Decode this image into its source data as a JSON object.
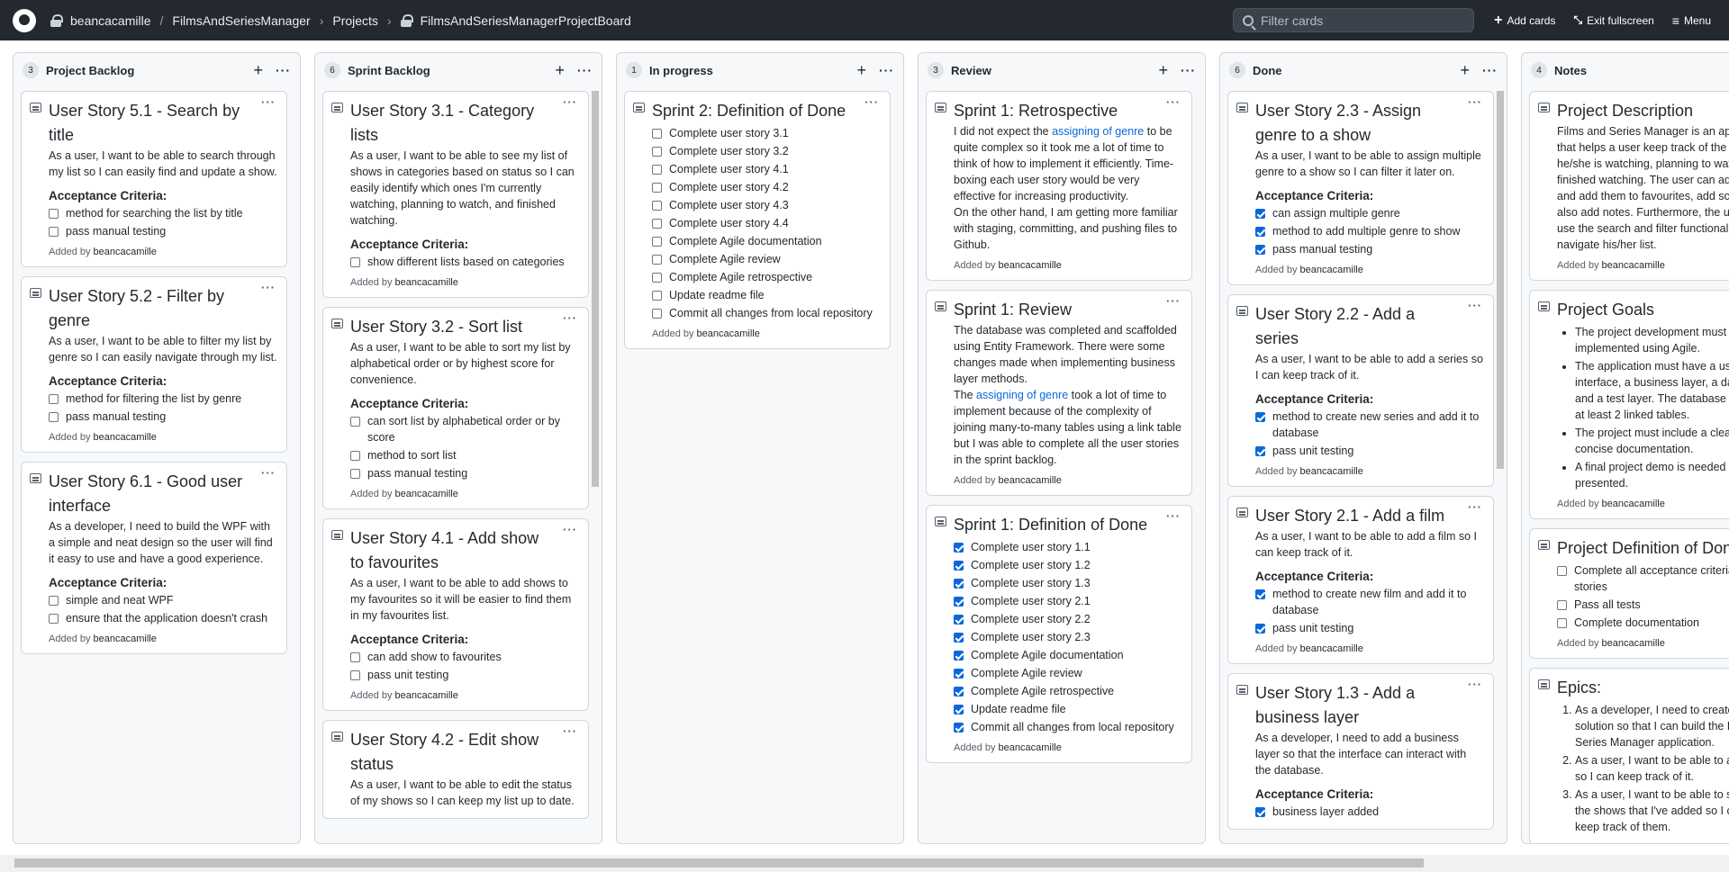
{
  "topbar": {
    "owner": "beancacamille",
    "slash": "/",
    "repo": "FilmsAndSeriesManager",
    "projects": "Projects",
    "project_name": "FilmsAndSeriesManagerProjectBoard",
    "search_placeholder": "Filter cards",
    "add_cards": "Add cards",
    "exit_fullscreen": "Exit fullscreen",
    "menu": "Menu"
  },
  "added_by_label": "Added by",
  "columns": [
    {
      "count": "3",
      "title": "Project Backlog",
      "cards": [
        {
          "title": "User Story 5.1 - Search by title",
          "desc": "As a user, I want to be able to search through my list so I can easily find and update a show.",
          "criteria_label": "Acceptance Criteria:",
          "items": [
            {
              "text": "method for searching the list by title",
              "checked": false
            },
            {
              "text": "pass manual testing",
              "checked": false
            }
          ],
          "author": "beancacamille"
        },
        {
          "title": "User Story 5.2 - Filter by genre",
          "desc": "As a user, I want to be able to filter my list by genre so I can easily navigate through my list.",
          "criteria_label": "Acceptance Criteria:",
          "items": [
            {
              "text": "method for filtering the list by genre",
              "checked": false
            },
            {
              "text": "pass manual testing",
              "checked": false
            }
          ],
          "author": "beancacamille"
        },
        {
          "title": "User Story 6.1 - Good user interface",
          "desc": "As a developer, I need to build the WPF with a simple and neat design so the user will find it easy to use and have a good experience.",
          "criteria_label": "Acceptance Criteria:",
          "items": [
            {
              "text": "simple and neat WPF",
              "checked": false
            },
            {
              "text": "ensure that the application doesn't crash",
              "checked": false
            }
          ],
          "author": "beancacamille"
        }
      ]
    },
    {
      "count": "6",
      "title": "Sprint Backlog",
      "cards": [
        {
          "title": "User Story 3.1 - Category lists",
          "desc": "As a user, I want to be able to see my list of shows in categories based on status so I can easily identify which ones I'm currently watching, planning to watch, and finished watching.",
          "criteria_label": "Acceptance Criteria:",
          "items": [
            {
              "text": "show different lists based on categories",
              "checked": false
            }
          ],
          "author": "beancacamille"
        },
        {
          "title": "User Story 3.2 - Sort list",
          "desc": "As a user, I want to be able to sort my list by alphabetical order or by highest score for convenience.",
          "criteria_label": "Acceptance Criteria:",
          "items": [
            {
              "text": "can sort list by alphabetical order or by score",
              "checked": false
            },
            {
              "text": "method to sort list",
              "checked": false
            },
            {
              "text": "pass manual testing",
              "checked": false
            }
          ],
          "author": "beancacamille"
        },
        {
          "title": "User Story 4.1 - Add show to favourites",
          "desc": "As a user, I want to be able to add shows to my favourites so it will be easier to find them in my favourites list.",
          "criteria_label": "Acceptance Criteria:",
          "items": [
            {
              "text": "can add show to favourites",
              "checked": false
            },
            {
              "text": "pass unit testing",
              "checked": false
            }
          ],
          "author": "beancacamille"
        },
        {
          "title": "User Story 4.2 - Edit show status",
          "desc": "As a user, I want to be able to edit the status of my shows so I can keep my list up to date.",
          "criteria_label": "",
          "items": [],
          "author": ""
        }
      ]
    },
    {
      "count": "1",
      "title": "In progress",
      "cards": [
        {
          "title": "Sprint 2: Definition of Done",
          "desc": "",
          "criteria_label": "",
          "items": [
            {
              "text": "Complete user story 3.1",
              "checked": false
            },
            {
              "text": "Complete user story 3.2",
              "checked": false
            },
            {
              "text": "Complete user story 4.1",
              "checked": false
            },
            {
              "text": "Complete user story 4.2",
              "checked": false
            },
            {
              "text": "Complete user story 4.3",
              "checked": false
            },
            {
              "text": "Complete user story 4.4",
              "checked": false
            },
            {
              "text": "Complete Agile documentation",
              "checked": false
            },
            {
              "text": "Complete Agile review",
              "checked": false
            },
            {
              "text": "Complete Agile retrospective",
              "checked": false
            },
            {
              "text": "Update readme file",
              "checked": false
            },
            {
              "text": "Commit all changes from local repository",
              "checked": false
            }
          ],
          "author": "beancacamille"
        }
      ]
    },
    {
      "count": "3",
      "title": "Review",
      "cards": [
        {
          "title": "Sprint 1: Retrospective",
          "rich": [
            {
              "before": "I did not expect the ",
              "link": "assigning of genre",
              "after": " to be quite complex so it took me a lot of time to think of how to implement it efficiently. Time-boxing each user story would be very effective for increasing productivity."
            },
            {
              "before": "On the other hand, I am getting more familiar with staging, committing, and pushing files to Github.",
              "link": "",
              "after": ""
            }
          ],
          "items": [],
          "author": "beancacamille"
        },
        {
          "title": "Sprint 1: Review",
          "rich": [
            {
              "before": "The database was completed and scaffolded using Entity Framework. There were some changes made when implementing business layer methods.",
              "link": "",
              "after": ""
            },
            {
              "before": "The ",
              "link": "assigning of genre",
              "after": " took a lot of time to implement because of the complexity of joining many-to-many tables using a link table but I was able to complete all the user stories in the sprint backlog."
            }
          ],
          "items": [],
          "author": "beancacamille"
        },
        {
          "title": "Sprint 1: Definition of Done",
          "items": [
            {
              "text": "Complete user story 1.1",
              "checked": true
            },
            {
              "text": "Complete user story 1.2",
              "checked": true
            },
            {
              "text": "Complete user story 1.3",
              "checked": true
            },
            {
              "text": "Complete user story 2.1",
              "checked": true
            },
            {
              "text": "Complete user story 2.2",
              "checked": true
            },
            {
              "text": "Complete user story 2.3",
              "checked": true
            },
            {
              "text": "Complete Agile documentation",
              "checked": true
            },
            {
              "text": "Complete Agile review",
              "checked": true
            },
            {
              "text": "Complete Agile retrospective",
              "checked": true
            },
            {
              "text": "Update readme file",
              "checked": true
            },
            {
              "text": "Commit all changes from local repository",
              "checked": true
            }
          ],
          "author": "beancacamille"
        }
      ]
    },
    {
      "count": "6",
      "title": "Done",
      "cards": [
        {
          "title": "User Story 2.3 - Assign genre to a show",
          "desc": "As a user, I want to be able to assign multiple genre to a show so I can filter it later on.",
          "criteria_label": "Acceptance Criteria:",
          "items": [
            {
              "text": "can assign multiple genre",
              "checked": true
            },
            {
              "text": "method to add multiple genre to show",
              "checked": true
            },
            {
              "text": "pass manual testing",
              "checked": true
            }
          ],
          "author": "beancacamille"
        },
        {
          "title": "User Story 2.2 - Add a series",
          "desc": "As a user, I want to be able to add a series so I can keep track of it.",
          "criteria_label": "Acceptance Criteria:",
          "items": [
            {
              "text": "method to create new series and add it to database",
              "checked": true
            },
            {
              "text": "pass unit testing",
              "checked": true
            }
          ],
          "author": "beancacamille"
        },
        {
          "title": "User Story 2.1 - Add a film",
          "desc": "As a user, I want to be able to add a film so I can keep track of it.",
          "criteria_label": "Acceptance Criteria:",
          "items": [
            {
              "text": "method to create new film and add it to database",
              "checked": true
            },
            {
              "text": "pass unit testing",
              "checked": true
            }
          ],
          "author": "beancacamille"
        },
        {
          "title": "User Story 1.3 - Add a business layer",
          "desc": "As a developer, I need to add a business layer so that the interface can interact with the database.",
          "criteria_label": "Acceptance Criteria:",
          "items": [
            {
              "text": "business layer added",
              "checked": true
            }
          ],
          "author": ""
        }
      ]
    },
    {
      "count": "4",
      "title": "Notes",
      "cards": [
        {
          "title": "Project Description",
          "desc": "Films and Series Manager is an application that helps a user keep track of the shows that he/she is watching, planning to watch, and finished watching. The user can add shows and add them to favourites, add scores, and also add notes. Furthermore, the user can use the search and filter functionality to easily navigate his/her list.",
          "items": [],
          "author": "beancacamille"
        },
        {
          "title": "Project Goals",
          "bullets": [
            "The project development must be implemented using Agile.",
            "The application must have a user interface, a business layer, a data layer and a test layer. The database must have at least 2 linked tables.",
            "The project must include a clear and concise documentation.",
            "A final project demo is needed to be presented."
          ],
          "items": [],
          "author": "beancacamille"
        },
        {
          "title": "Project Definition of Done",
          "items": [
            {
              "text": "Complete all acceptance criteria in user stories",
              "checked": false
            },
            {
              "text": "Pass all tests",
              "checked": false
            },
            {
              "text": "Complete documentation",
              "checked": false
            }
          ],
          "author": "beancacamille"
        },
        {
          "title": "Epics:",
          "numbered": [
            "As a developer, I need to create a project solution so that I can build the Film and Series Manager application.",
            "As a user, I want to be able to add a show so I can keep track of it.",
            "As a user, I want to be able to see a list of the shows that I've added so I can easily keep track of them."
          ],
          "items": [],
          "author": ""
        }
      ]
    }
  ]
}
